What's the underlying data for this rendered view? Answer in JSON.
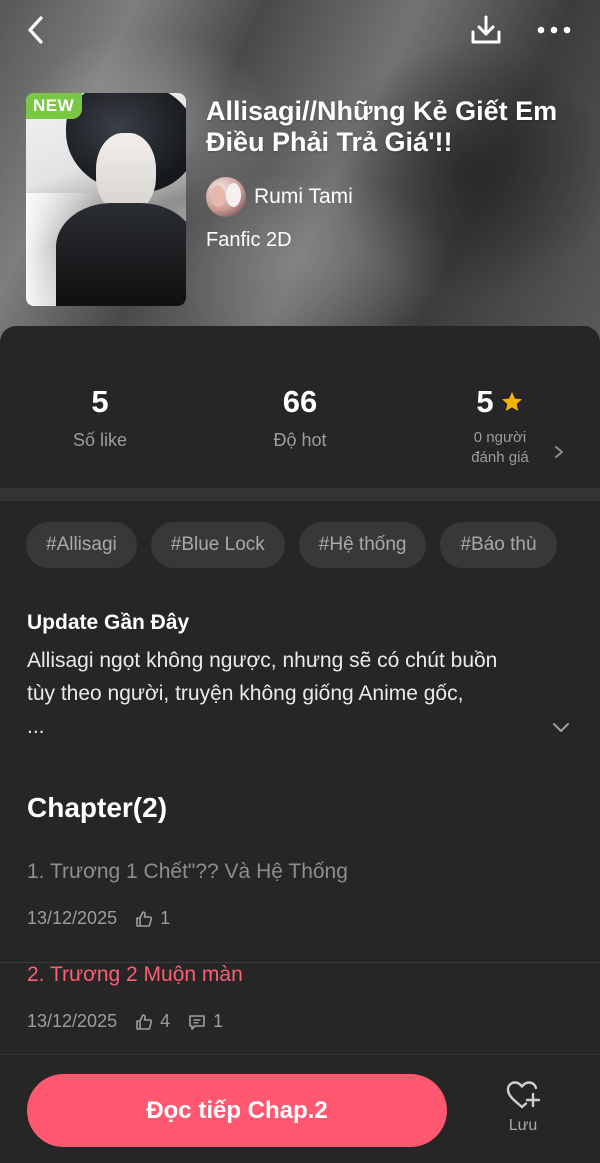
{
  "header": {
    "back_icon": "chevron-left-icon",
    "download_icon": "download-icon",
    "more_icon": "more-horizontal-icon"
  },
  "book": {
    "badge": "NEW",
    "title": "Allisagi//Những Kẻ Giết Em Điều Phải Trả Giá'!!",
    "author": "Rumi Tami",
    "category": "Fanfic 2D"
  },
  "stats": {
    "likes": {
      "value": "5",
      "label": "Số like"
    },
    "hot": {
      "value": "66",
      "label": "Độ hot"
    },
    "rating": {
      "value": "5",
      "label_line1": "0 người",
      "label_line2": "đánh giá"
    }
  },
  "tags": [
    "#Allisagi",
    "#Blue Lock",
    "#Hệ thống",
    "#Báo thù"
  ],
  "update": {
    "title": "Update Gần Đây",
    "line1": "Allisagi ngọt không ngược, nhưng sẽ có chút buồn",
    "line2": "tùy theo người, truyện không giống Anime gốc,",
    "line3": "..."
  },
  "chapters": {
    "heading": "Chapter(2)",
    "items": [
      {
        "name": "1. Trương 1 Chết\"?? Và Hệ Thống",
        "date": "13/12/2025",
        "likes": "1"
      },
      {
        "name": "2. Trương 2 Muộn màn",
        "date": "13/12/2025",
        "likes": "4",
        "comments": "1"
      }
    ]
  },
  "bottom": {
    "read_label": "Đọc tiếp Chap.2",
    "save_label": "Lưu"
  },
  "colors": {
    "accent": "#ff5870",
    "star": "#f5b400",
    "new_badge": "#79c743",
    "background": "#262626"
  }
}
